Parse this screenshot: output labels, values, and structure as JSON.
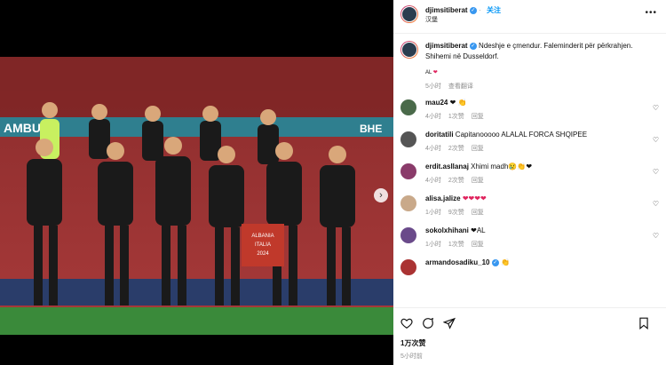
{
  "post": {
    "username": "djimsitiberat",
    "follow_label": "关注",
    "location": "汉堡",
    "caption_user": "djimsitiberat",
    "caption_line1": "Ndeshje e çmendur. Faleminderit për përkrahjen.",
    "caption_line2": "Shihemi në Dusseldorf.",
    "caption_flag": "AL",
    "caption_heart": "❤",
    "caption_time": "5小时",
    "caption_translate": "查看翻译",
    "likes": "1万次赞",
    "timestamp": "5小时前"
  },
  "comments": [
    {
      "user": "mau24",
      "text": "❤ 👏",
      "time": "4小时",
      "likes": "1次赞",
      "reply": "回复"
    },
    {
      "user": "doritatili",
      "text": "Capitanooooo ALALAL FORCA SHQIPEE",
      "time": "4小时",
      "likes": "2次赞",
      "reply": "回复"
    },
    {
      "user": "erdit.asllanaj",
      "text": "Xhimi madh😢👏❤",
      "time": "4小时",
      "likes": "2次赞",
      "reply": "回复"
    },
    {
      "user": "alisa.jalize",
      "text": "❤❤❤❤",
      "time": "1小时",
      "likes": "9次赞",
      "reply": "回复"
    },
    {
      "user": "sokolxhihani",
      "text": "❤AL",
      "time": "1小时",
      "likes": "1次赞",
      "reply": "回复"
    },
    {
      "user": "armandosadiku_10",
      "text": "👏",
      "time": "",
      "likes": "",
      "reply": ""
    }
  ],
  "photo": {
    "banner_text": "AMBU",
    "banner_right": "BHE",
    "pennant_lines": [
      "ALBANIA",
      "ITALIA",
      "2024"
    ]
  },
  "colors": {
    "accent": "#0095f6",
    "heart": "#e0245e"
  },
  "icons": [
    "heart-icon",
    "comment-icon",
    "share-icon",
    "bookmark-icon",
    "more-icon",
    "next-icon"
  ]
}
